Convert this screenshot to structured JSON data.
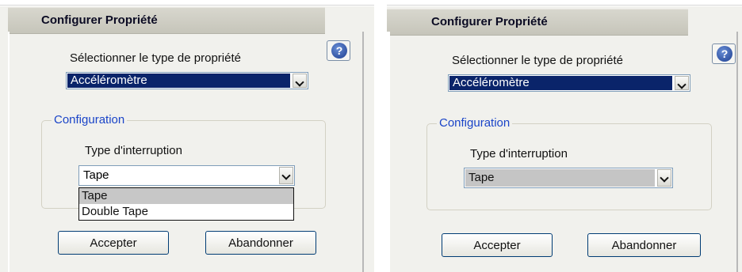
{
  "left_dialog": {
    "title": "Configurer Propriété",
    "help_glyph": "?",
    "property_type_label": "Sélectionner le type de propriété",
    "property_type_value": "Accéléromètre",
    "group_title": "Configuration",
    "interrupt_label": "Type d'interruption",
    "interrupt_value": "Tape",
    "interrupt_options": [
      "Tape",
      "Double Tape"
    ],
    "accept_label": "Accepter",
    "cancel_label": "Abandonner"
  },
  "right_dialog": {
    "title": "Configurer Propriété",
    "help_glyph": "?",
    "property_type_label": "Sélectionner le type de propriété",
    "property_type_value": "Accéléromètre",
    "group_title": "Configuration",
    "interrupt_label": "Type d'interruption",
    "interrupt_value": "Tape",
    "accept_label": "Accepter",
    "cancel_label": "Abandonner"
  },
  "colors": {
    "dialog_bg": "#f1f1ed",
    "selected_bg": "#0a246a",
    "group_title": "#1a44c8",
    "button_border": "#003c74",
    "highlight_option": "#c7c7c7"
  },
  "icons": [
    "help-icon",
    "chevron-down-icon"
  ]
}
